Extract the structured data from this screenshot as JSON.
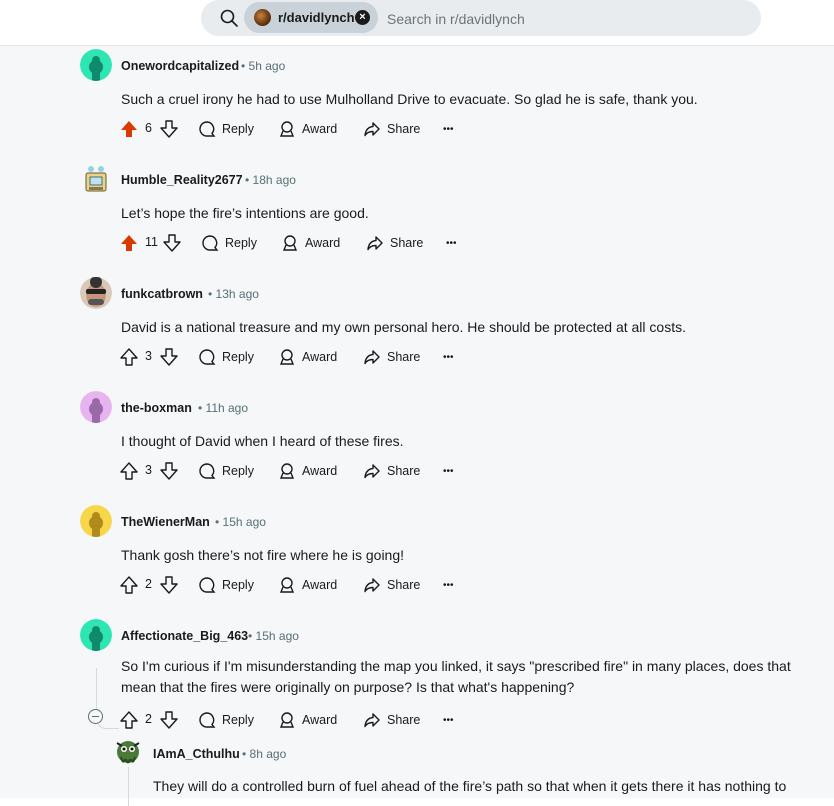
{
  "search": {
    "subreddit_chip": "r/davidlynch",
    "placeholder": "Search in r/davidlynch",
    "value": ""
  },
  "action_labels": {
    "reply": "Reply",
    "award": "Award",
    "share": "Share",
    "more": "•••"
  },
  "colors": {
    "upvoted": "#d93a00",
    "muted": "#576f76",
    "thread": "#d6dadc"
  },
  "comments": [
    {
      "author": "Onewordcapitalized",
      "time": "5h ago",
      "text": "Such a cruel irony he had to use Mulholland Drive to evacuate. So glad he is safe, thank you.",
      "votes": "6",
      "upvoted": true,
      "avatar": "snoo-teal"
    },
    {
      "author": "Humble_Reality2677",
      "time": "18h ago",
      "text": "Let’s hope the fire’s intentions are good.",
      "votes": "11",
      "upvoted": true,
      "avatar": "pixel-robot"
    },
    {
      "author": "funkcatbrown",
      "time": "13h ago",
      "text": "David is a national treasure and my own personal hero. He should be protected at all costs.",
      "votes": "3",
      "upvoted": false,
      "avatar": "photo-face"
    },
    {
      "author": "the-boxman",
      "time": "11h ago",
      "text": "I thought of David when I heard of these fires.",
      "votes": "3",
      "upvoted": false,
      "avatar": "snoo-lilac"
    },
    {
      "author": "TheWienerMan",
      "time": "15h ago",
      "text": "Thank gosh there’s not fire where he is going!",
      "votes": "2",
      "upvoted": false,
      "avatar": "snoo-yellow"
    },
    {
      "author": "Affectionate_Big_463",
      "time": "15h ago",
      "text": "So I'm curious if I'm misunderstanding the map you linked, it says \"prescribed fire\" in many places, does that mean that the fires were originally on purpose? Is that what's happening?",
      "votes": "2",
      "upvoted": false,
      "avatar": "snoo-teal"
    },
    {
      "author": "IAmA_Cthulhu",
      "time": "8h ago",
      "text": "They will do a controlled burn of fuel ahead of the fire’s path so that when it gets there it has nothing to",
      "avatar": "cthulhu-snoo"
    }
  ]
}
